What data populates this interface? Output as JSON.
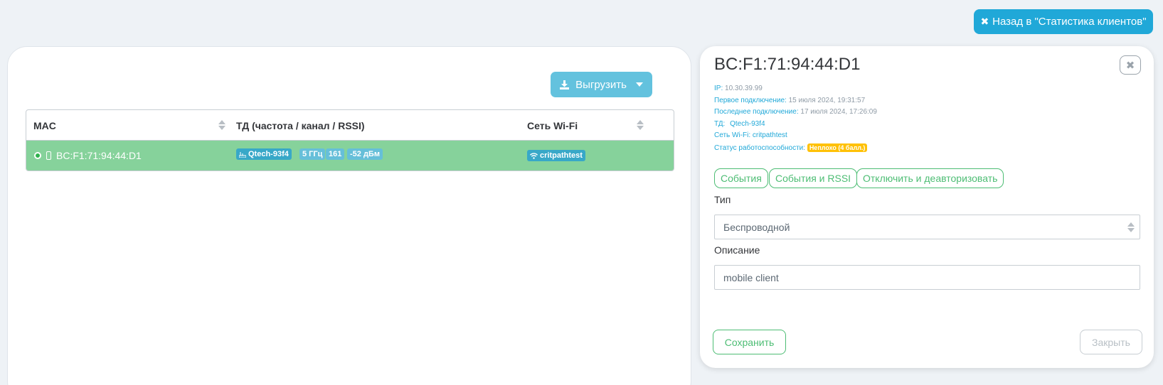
{
  "header": {
    "back_button_label": "Назад в \"Статистика клиентов\""
  },
  "left": {
    "export_button_label": "Выгрузить",
    "table": {
      "columns": [
        "MAC",
        "ТД (частота / канал / RSSI)",
        "Сеть Wi-Fi"
      ],
      "rows": [
        {
          "mac": "BC:F1:71:94:44:D1",
          "ap": "Qtech-93f4",
          "frequency": "5 ГГц",
          "channel": "161",
          "rssi": "-52 дБм",
          "ssid": "critpathtest"
        }
      ]
    }
  },
  "detail": {
    "title": "BC:F1:71:94:44:D1",
    "ip_label": "IP:",
    "ip_value": "10.30.39.99",
    "first_conn_label": "Первое подключение:",
    "first_conn_value": "15 июля 2024, 19:31:57",
    "last_conn_label": "Последнее подключение:",
    "last_conn_value": "17 июля 2024, 17:26:09",
    "ap_label": "ТД:",
    "ap_value": "Qtech-93f4",
    "ssid_label": "Сеть Wi-Fi:",
    "ssid_value": "critpathtest",
    "health_label": "Статус работоспособности:",
    "health_value": "Неплохо (4 балл.)",
    "actions": {
      "events": "События",
      "events_rssi": "События и RSSI",
      "disconnect": "Отключить и деавторизовать"
    },
    "type_label": "Тип",
    "type_value": "Беспроводной",
    "description_label": "Описание",
    "description_value": "mobile client",
    "save_label": "Сохранить",
    "close_label": "Закрыть"
  },
  "colors": {
    "primary": "#20a8d8",
    "info": "#63c2de",
    "success": "#4dbd74",
    "row_selected": "#86d29b",
    "warning": "#ffc107"
  }
}
